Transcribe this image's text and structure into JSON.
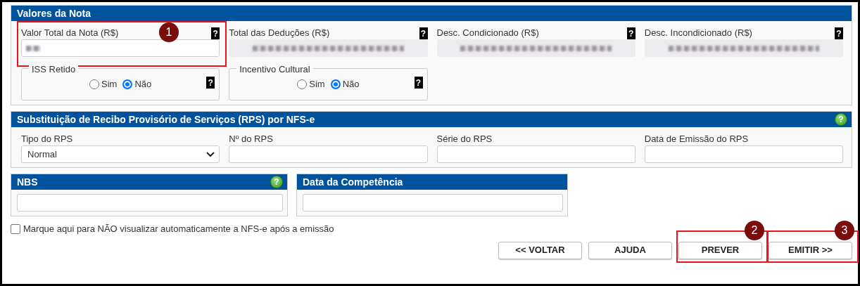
{
  "sections": [
    {
      "title": "Valores da Nota",
      "fields": [
        {
          "kind": "input",
          "label": "Valor Total da Nota (R$)",
          "help": "?",
          "blurred": true,
          "disabled": false,
          "step": "1"
        },
        {
          "kind": "input",
          "label": "Total das Deduções (R$)",
          "help": "?",
          "blurred": true,
          "disabled": true
        },
        {
          "kind": "input",
          "label": "Desc. Condicionado (R$)",
          "help": "?",
          "blurred": true,
          "disabled": true
        },
        {
          "kind": "input",
          "label": "Desc. Incondicionado (R$)",
          "help": "?",
          "blurred": true,
          "disabled": true
        },
        {
          "kind": "radio-group",
          "legend": "ISS Retido",
          "help": "?",
          "options": [
            {
              "label": "Sim",
              "selected": false
            },
            {
              "label": "Não",
              "selected": true
            }
          ]
        },
        {
          "kind": "radio-group",
          "legend": "Incentivo Cultural",
          "help": "?",
          "options": [
            {
              "label": "Sim",
              "selected": false
            },
            {
              "label": "Não",
              "selected": true
            }
          ]
        }
      ]
    },
    {
      "title": "Substituição de Recibo Provisório de Serviços (RPS) por NFS-e",
      "help": "?",
      "fields": [
        {
          "kind": "select",
          "label": "Tipo do RPS",
          "value": "Normal"
        },
        {
          "kind": "input",
          "label": "Nº do RPS",
          "disabled": false
        },
        {
          "kind": "input",
          "label": "Série do RPS",
          "disabled": false
        },
        {
          "kind": "input",
          "label": "Data de Emissão do RPS",
          "disabled": false
        }
      ]
    }
  ],
  "small_panels": [
    {
      "title": "NBS",
      "help": "?"
    },
    {
      "title": "Data da Competência"
    }
  ],
  "checkbox": {
    "label": "Marque aqui para NÃO visualizar automaticamente a NFS-e após a emissão",
    "checked": false
  },
  "buttons": [
    {
      "label": "<< VOLTAR"
    },
    {
      "label": "AJUDA"
    },
    {
      "label": "PREVER",
      "step": "2"
    },
    {
      "label": "EMITIR >>",
      "step": "3"
    }
  ]
}
